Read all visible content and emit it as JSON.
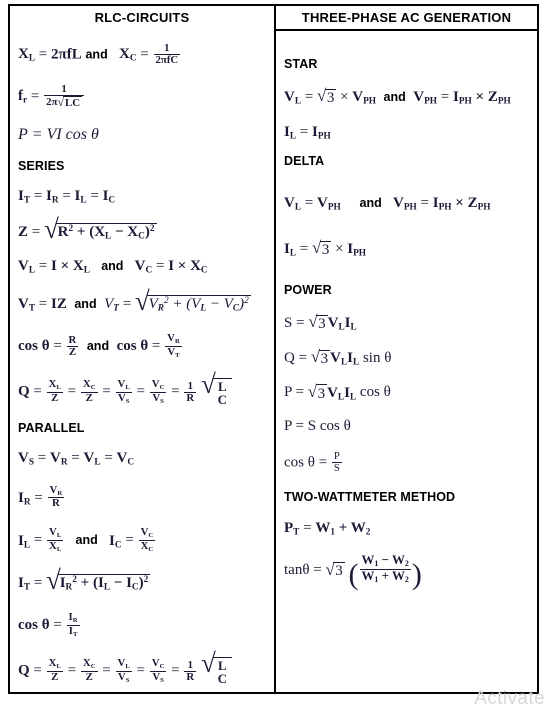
{
  "document": {
    "watermark": "Activate"
  },
  "left_column": {
    "title": "RLC-CIRCUITS",
    "conjunction": "and",
    "sections": [
      {
        "heading": "SERIES"
      },
      {
        "heading": "PARALLEL"
      }
    ],
    "formulas": {
      "xl": "X_L = 2πfL",
      "xc": "X_C = 1 / (2πfC)",
      "fr": "f_r = 1 / (2π√(LC))",
      "power": "P = VI cos θ",
      "series_current": "I_T = I_R = I_L = I_C",
      "impedance": "Z = √(R² + (X_L − X_C)²)",
      "vl": "V_L = I × X_L",
      "vc": "V_C = I × X_C",
      "vt_iz": "V_T = IZ",
      "vt_root": "V_T = √(V_R² + (V_L − V_C)²)",
      "cos_rz": "cos θ = R / Z",
      "cos_vrvt": "cos θ = V_R / V_T",
      "q_series": "Q = X_L/Z = X_C/Z = V_L/V_S = V_C/V_S = (1/R)√(L/C)",
      "parallel_voltage": "V_S = V_R = V_L = V_C",
      "ir": "I_R = V_R / R",
      "il": "I_L = V_L / X_L",
      "ic": "I_C = V_C / X_C",
      "it_root": "I_T = √(I_R² + (I_L − I_C)²)",
      "cos_irit": "cos θ = I_R / I_T",
      "q_parallel": "Q = X_L/Z = X_C/Z = V_L/V_S = V_C/V_S = (1/R)√(L/C)"
    },
    "symbols": {
      "X": "X",
      "L": "L",
      "C": "C",
      "R": "R",
      "Z": "Z",
      "I": "I",
      "V": "V",
      "P": "P",
      "Q": "Q",
      "S": "S",
      "T": "T",
      "f": "f",
      "r": "r",
      "two_pi_f_L": "2πfL",
      "one": "1",
      "two_pi_f_C": "2πfC",
      "two_pi": "2π",
      "LC": "LC",
      "VI": "VI",
      "cos": "cos",
      "theta": "θ",
      "equals": "=",
      "times": "×",
      "minus": "−",
      "plus": "+",
      "sqrt": "√",
      "two": "2",
      "IZ": "IZ"
    }
  },
  "right_column": {
    "title": "THREE-PHASE AC GENERATION",
    "conjunction": "and",
    "sections": [
      {
        "heading": "STAR"
      },
      {
        "heading": "DELTA"
      },
      {
        "heading": "POWER"
      },
      {
        "heading": "TWO-WATTMETER METHOD"
      }
    ],
    "formulas": {
      "star_vl": "V_L = √3 × V_PH",
      "star_vph": "V_PH = I_PH × Z_PH",
      "star_il": "I_L = I_PH",
      "delta_vl": "V_L = V_PH",
      "delta_vph": "V_PH = I_PH × Z_PH",
      "delta_il": "I_L = √3 × I_PH",
      "apparent": "S = √3 V_L I_L",
      "reactive": "Q = √3 V_L I_L sin θ",
      "active": "P = √3 V_L I_L cos θ",
      "p_scos": "P = S cos θ",
      "pf": "cos θ = P / S",
      "pt": "P_T = W₁ + W₂",
      "tan_theta": "tanθ = √3 ((W₁ − W₂) / (W₁ + W₂))"
    },
    "symbols": {
      "V": "V",
      "I": "I",
      "Z": "Z",
      "L": "L",
      "PH": "PH",
      "S": "S",
      "P": "P",
      "Q": "Q",
      "W": "W",
      "T": "T",
      "three": "3",
      "one_sub": "1",
      "two_sub": "2",
      "sin": "sin",
      "cos": "cos",
      "tan": "tan",
      "theta": "θ",
      "equals": "=",
      "times": "×",
      "minus": "−",
      "plus": "+",
      "sqrt": "√"
    }
  }
}
